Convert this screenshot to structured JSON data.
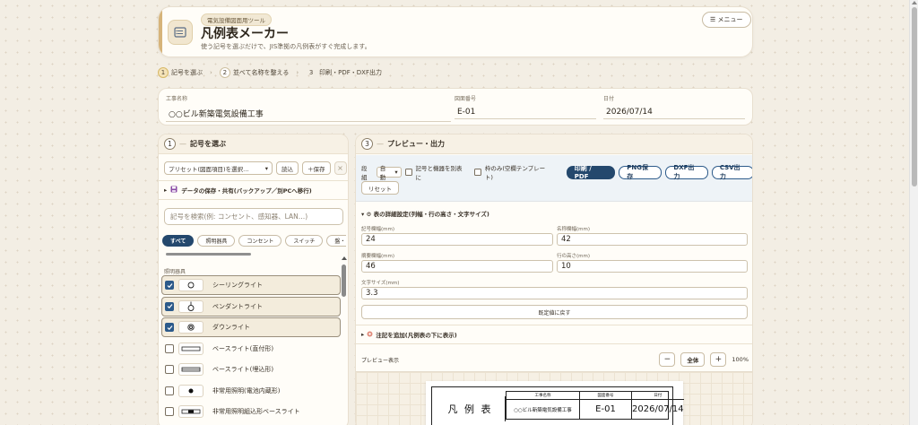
{
  "header": {
    "badge": "電気設備図面用ツール",
    "title": "凡例表メーカー",
    "subtitle": "使う記号を選ぶだけで、JIS準拠の凡例表がすぐ完成します。",
    "menu_label": "☰ メニュー"
  },
  "steps": [
    {
      "num": "1",
      "label": "記号を選ぶ"
    },
    {
      "num": "2",
      "label": "並べて名称を整える"
    },
    {
      "num": "3",
      "label": "印刷・PDF・DXF出力"
    }
  ],
  "project": {
    "name_label": "工事名称",
    "name_value": "○○ビル新築電気設備工事",
    "drawing_label": "図面番号",
    "drawing_value": "E-01",
    "date_label": "日付",
    "date_value": "2026/07/14"
  },
  "left": {
    "num": "1",
    "title": "記号を選ぶ",
    "preset_placeholder": "プリセット(図面項目)を選択…",
    "load_label": "読込",
    "save_label": "＋保存",
    "clear_label": "×",
    "data_section": "データの保存・共有(バックアップ／別PCへ移行)",
    "search_placeholder": "記号を検索(例: コンセント、感知器、LAN…)",
    "categories": [
      "すべて",
      "照明器具",
      "コンセント",
      "スイッチ",
      "盤・キャビネット"
    ],
    "group_label": "照明器具",
    "symbols": [
      {
        "name": "シーリングライト",
        "checked": true,
        "icon": "ceiling-light-icon"
      },
      {
        "name": "ペンダントライト",
        "checked": true,
        "icon": "pendant-light-icon"
      },
      {
        "name": "ダウンライト",
        "checked": true,
        "icon": "downlight-icon"
      },
      {
        "name": "ベースライト(直付形)",
        "checked": false,
        "icon": "base-light-surface-icon"
      },
      {
        "name": "ベースライト(埋込形)",
        "checked": false,
        "icon": "base-light-recessed-icon"
      },
      {
        "name": "非常用照明(電池内蔵形)",
        "checked": false,
        "icon": "emergency-light-icon"
      },
      {
        "name": "非常用照明組込形ベースライト",
        "checked": false,
        "icon": "emergency-base-light-icon"
      }
    ]
  },
  "right": {
    "num": "3",
    "title": "プレビュー・出力",
    "columns_label": "段組",
    "columns_value": "自動",
    "wiring_label": "記号と機器を別表に",
    "frame_only_label": "枠のみ(空欄テンプレート)",
    "print_label": "印刷 / PDF",
    "png_label": "PNG保存",
    "dxf_label": "DXF出力",
    "csv_label": "CSV出力",
    "reset_label": "リセット",
    "details_title": "▾ ⚙ 表の詳細設定(列幅・行の高さ・文字サイズ)",
    "symbol_width_label": "記号欄幅(mm)",
    "symbol_width_value": "24",
    "name_width_label": "名称欄幅(mm)",
    "name_width_value": "42",
    "remark_width_label": "摘要欄幅(mm)",
    "remark_width_value": "46",
    "row_height_label": "行の高さ(mm)",
    "row_height_value": "10",
    "font_size_label": "文字サイズ(mm)",
    "font_size_value": "3.3",
    "restore_label": "既定値に戻す",
    "note_label": "注記を追加(凡例表の下に表示)",
    "preview_label": "プレビュー表示",
    "zoom_minus": "−",
    "zoom_full": "全体",
    "zoom_plus": "+",
    "zoom_value": "100%"
  },
  "sheet": {
    "title": "凡 例 表",
    "h_name": "工事名称",
    "h_drawing": "図面番号",
    "h_date": "日付",
    "v_name": "○○ビル新築電気設備工事",
    "v_drawing": "E-01",
    "v_date": "2026/07/14"
  },
  "colors": {
    "primary": "#24486d",
    "accent": "#d6b47a",
    "background": "#f3eee4"
  }
}
